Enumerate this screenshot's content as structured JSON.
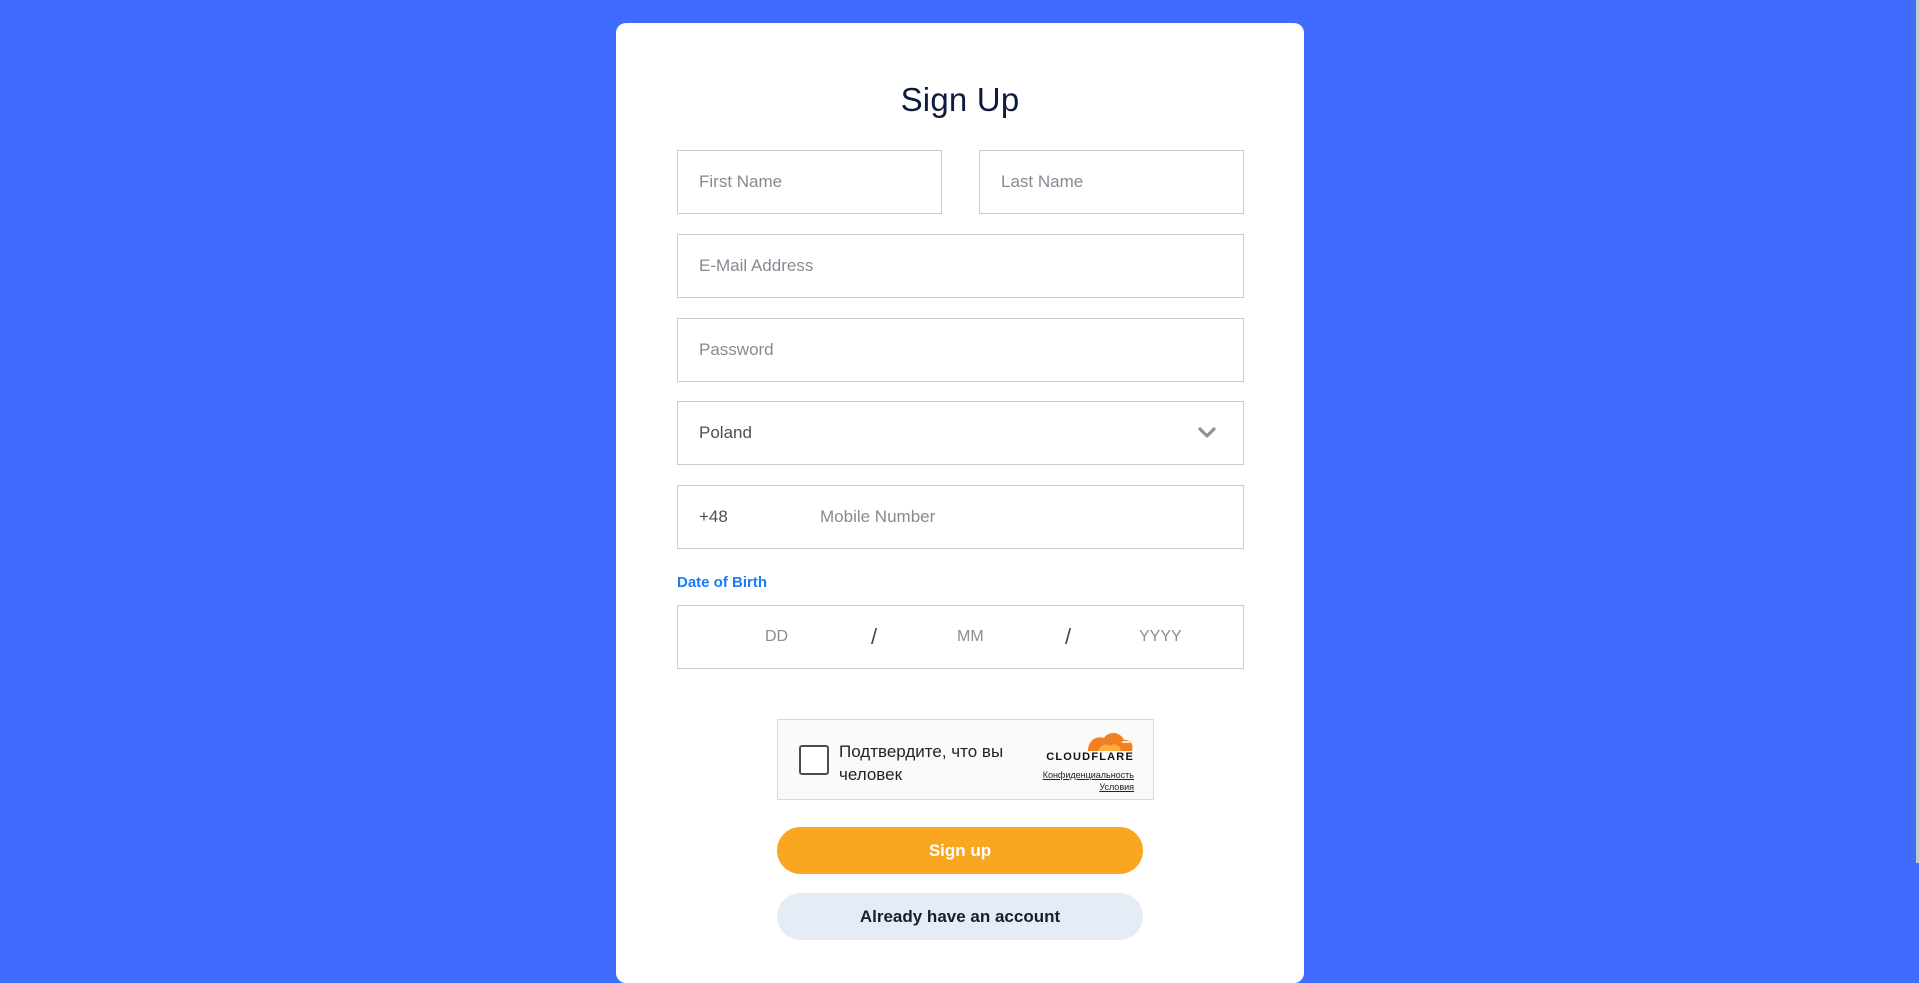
{
  "form": {
    "title": "Sign Up",
    "first_name_placeholder": "First Name",
    "last_name_placeholder": "Last Name",
    "email_placeholder": "E-Mail Address",
    "password_placeholder": "Password",
    "country_value": "Poland",
    "phone_code": "+48",
    "mobile_placeholder": "Mobile Number",
    "dob_label": "Date of Birth",
    "dob_day_placeholder": "DD",
    "dob_month_placeholder": "MM",
    "dob_year_placeholder": "YYYY",
    "dob_separator": "/"
  },
  "captcha": {
    "text": "Подтвердите, что вы человек",
    "brand": "CLOUDFLARE",
    "privacy_link": "Конфиденциальность",
    "terms_link": "Условия",
    "brand_color": "#f38020"
  },
  "buttons": {
    "signup_label": "Sign up",
    "login_label": "Already have an account"
  },
  "colors": {
    "background": "#406cfe",
    "primary_button": "#f9a620",
    "secondary_button": "#e6ecf5",
    "accent_label": "#1b7cf3"
  },
  "icons": {
    "country_dropdown": "chevron-down-icon",
    "captcha_logo": "cloudflare-logo"
  }
}
